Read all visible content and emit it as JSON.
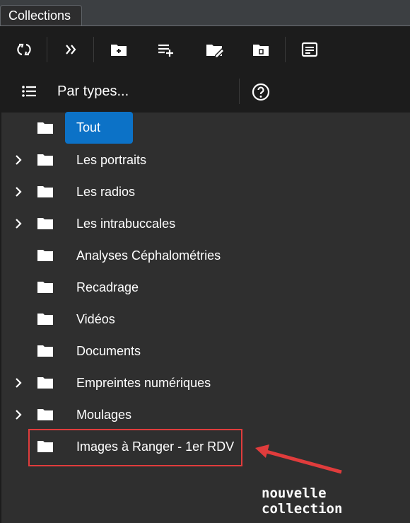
{
  "tab": {
    "title": "Collections"
  },
  "toolbar": {
    "buttons": [
      {
        "name": "refresh-icon"
      },
      {
        "name": "expand-all-icon"
      },
      {
        "name": "new-folder-icon"
      },
      {
        "name": "add-list-icon"
      },
      {
        "name": "edit-folder-icon"
      },
      {
        "name": "folder-badge-icon"
      },
      {
        "name": "panel-view-icon"
      }
    ]
  },
  "filter": {
    "label": "Par types...",
    "list_icon": "list-icon",
    "help_icon": "help-icon"
  },
  "tree": {
    "items": [
      {
        "label": "Tout",
        "expandable": false,
        "selected": true
      },
      {
        "label": "Les portraits",
        "expandable": true
      },
      {
        "label": "Les radios",
        "expandable": true
      },
      {
        "label": "Les intrabuccales",
        "expandable": true
      },
      {
        "label": "Analyses Céphalométries",
        "expandable": false
      },
      {
        "label": "Recadrage",
        "expandable": false
      },
      {
        "label": "Vidéos",
        "expandable": false
      },
      {
        "label": "Documents",
        "expandable": false
      },
      {
        "label": "Empreintes numériques",
        "expandable": true
      },
      {
        "label": "Moulages",
        "expandable": true
      },
      {
        "label": "Images à Ranger - 1er RDV",
        "expandable": false
      }
    ]
  },
  "annotation": {
    "text": "nouvelle collection",
    "color": "#e03c3c"
  },
  "colors": {
    "accent": "#0c72c7",
    "highlight": "#e03c3c"
  }
}
